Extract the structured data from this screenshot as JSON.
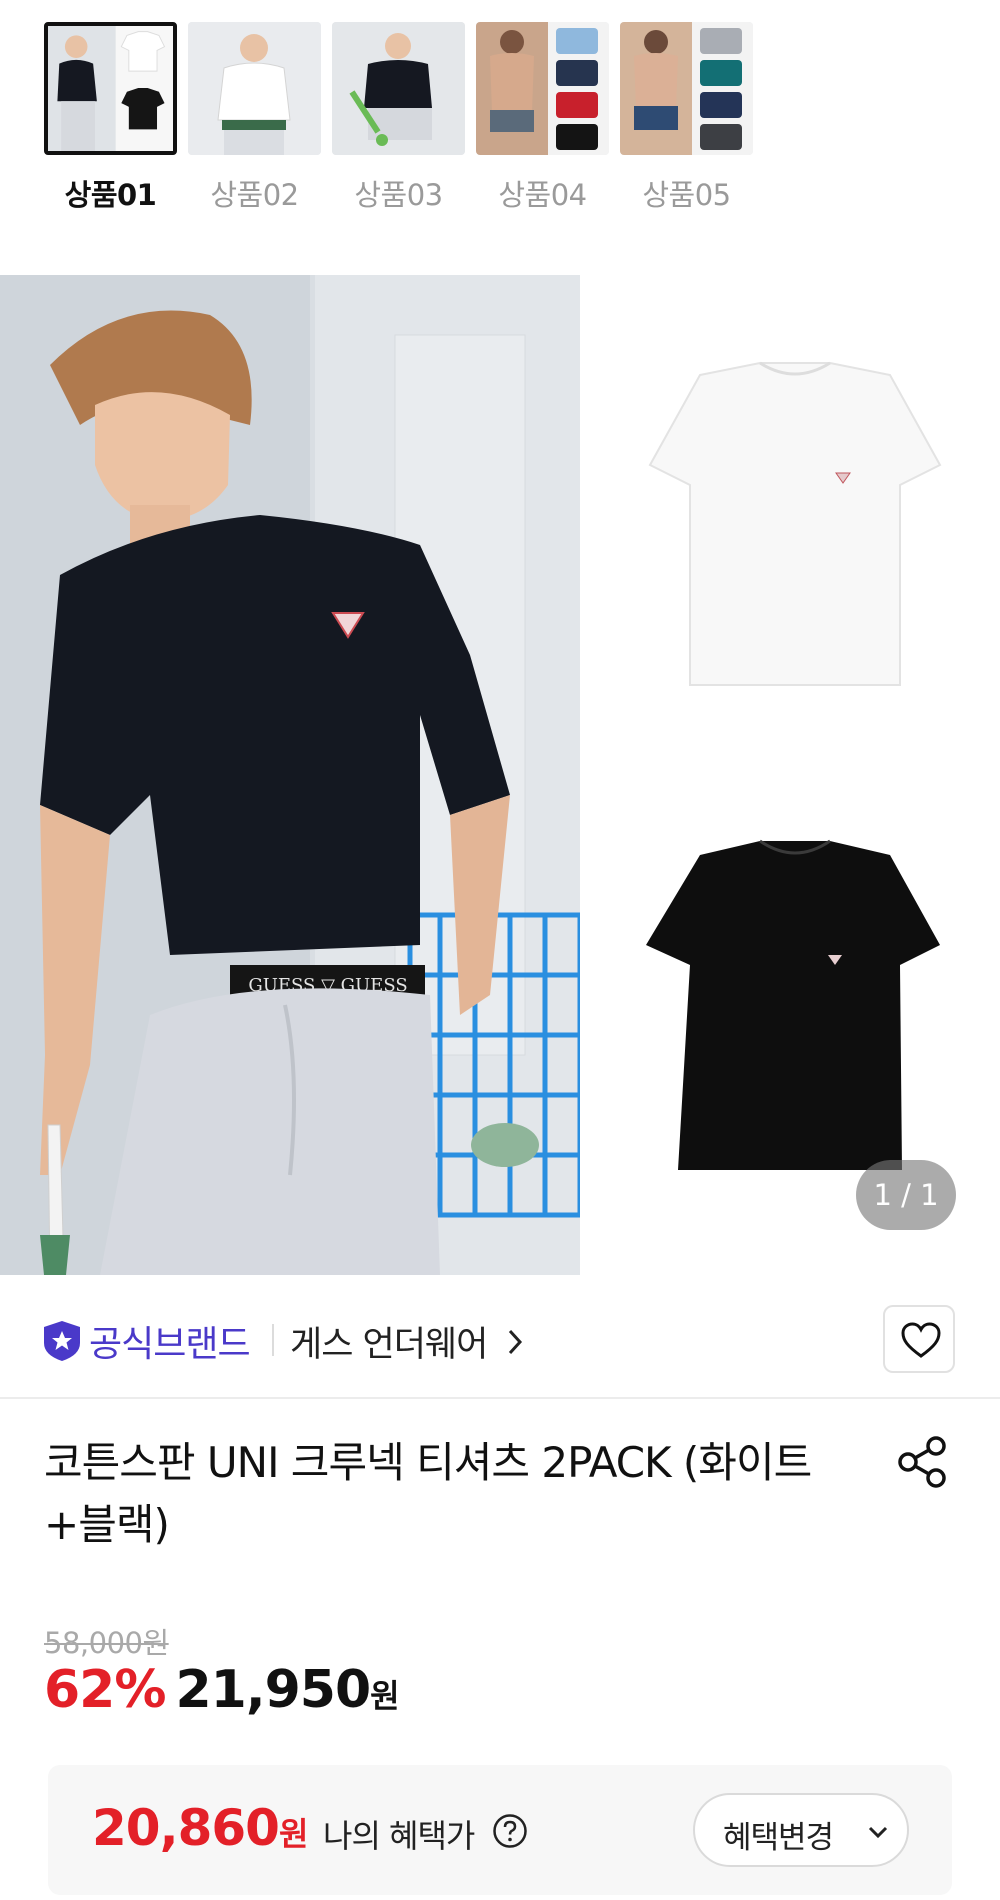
{
  "thumbnails": [
    {
      "label": "상품01",
      "active": true
    },
    {
      "label": "상품02",
      "active": false
    },
    {
      "label": "상품03",
      "active": false
    },
    {
      "label": "상품04",
      "active": false
    },
    {
      "label": "상품05",
      "active": false
    }
  ],
  "hero": {
    "counter": "1 / 1",
    "waistband_text": "GUESS ▽ GUESS"
  },
  "brand": {
    "official_label": "공식브랜드",
    "name": "게스 언더웨어"
  },
  "product": {
    "title": "코튼스판 UNI 크루넥 티셔츠 2PACK (화이트+블랙)"
  },
  "price": {
    "original": "58,000원",
    "discount": "62%",
    "sale": "21,950",
    "unit": "원"
  },
  "benefit": {
    "price": "20,860",
    "unit": "원",
    "label": "나의 혜택가",
    "help_icon": "question-circle-icon",
    "change_label": "혜택변경"
  },
  "colors": {
    "accent_red": "#e32028",
    "brand_purple": "#4a39c9"
  }
}
